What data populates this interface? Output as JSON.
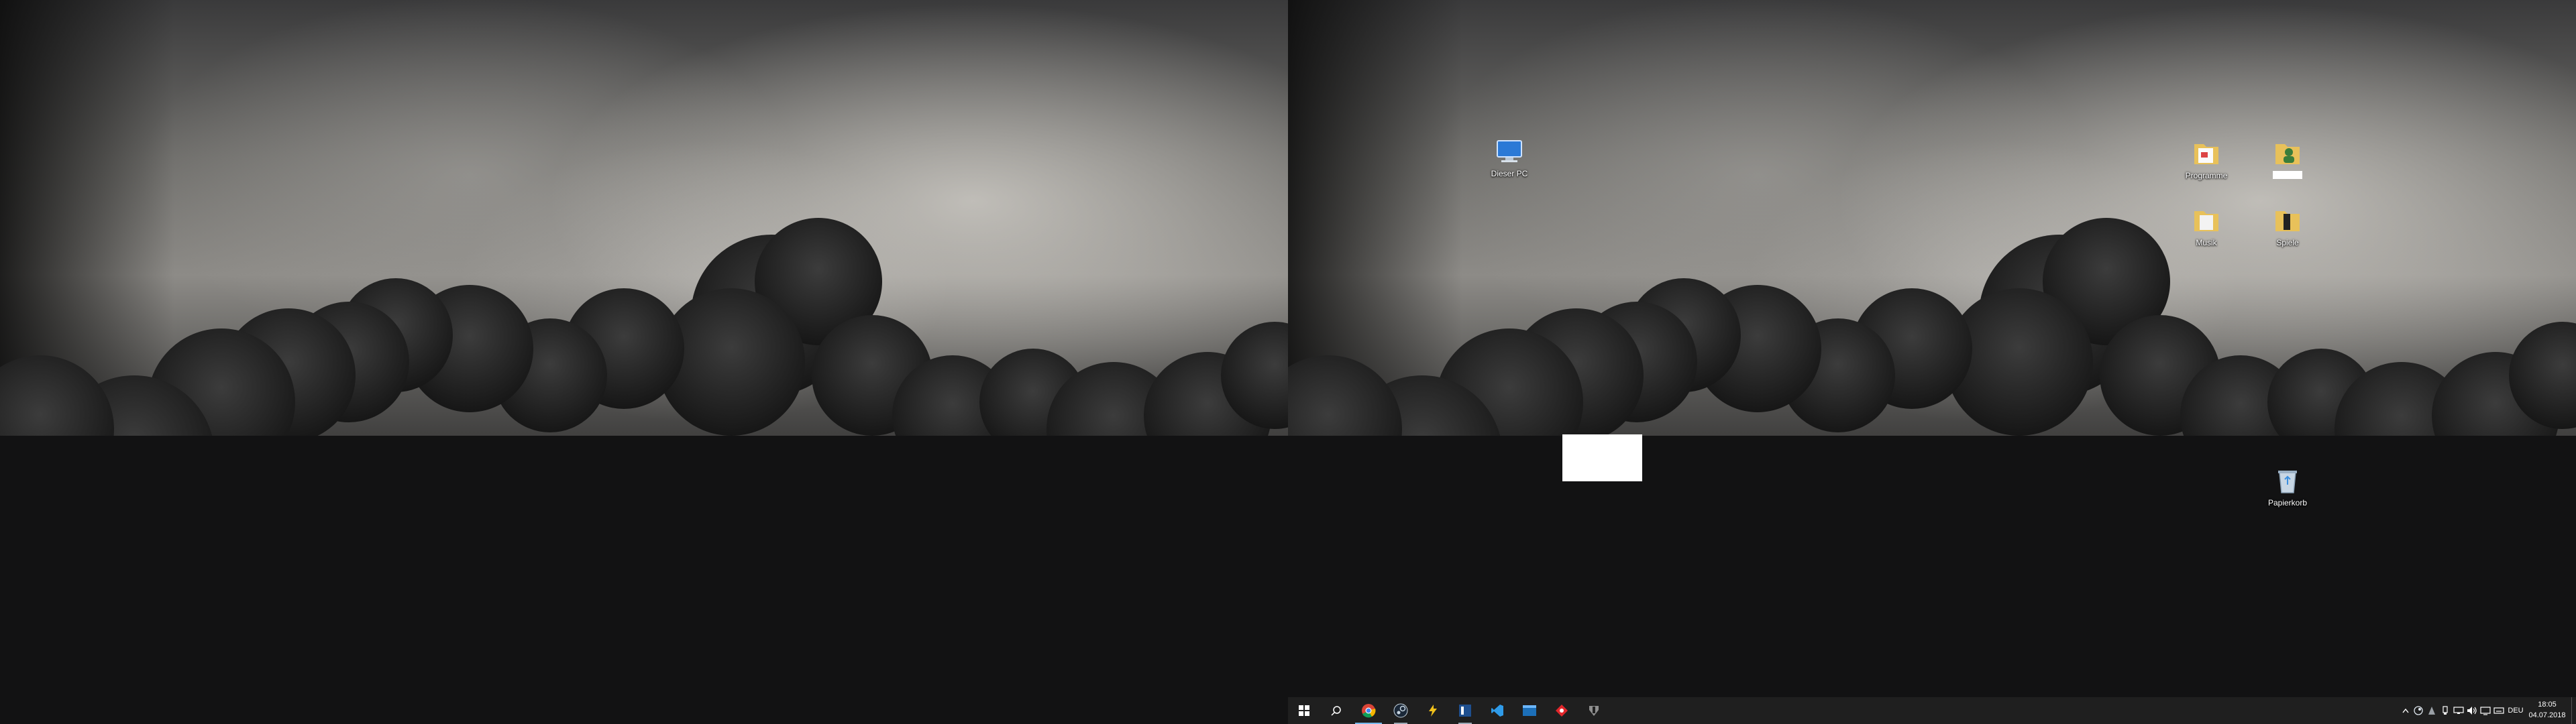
{
  "desktop": {
    "icons": [
      {
        "label": "Dieser PC",
        "icon": "computer-icon"
      },
      {
        "label": "Programme",
        "icon": "folder-icon"
      },
      {
        "label": "",
        "icon": "user-folder-icon"
      },
      {
        "label": "Musik",
        "icon": "folder-icon"
      },
      {
        "label": "Spiele",
        "icon": "folder-icon"
      },
      {
        "label": "Papierkorb",
        "icon": "recycle-bin-icon"
      }
    ]
  },
  "taskbar": {
    "pinned": [
      {
        "name": "start-button",
        "icon": "windows-icon"
      },
      {
        "name": "search-button",
        "icon": "search-icon"
      },
      {
        "name": "chrome",
        "icon": "chrome-icon"
      },
      {
        "name": "steam",
        "icon": "steam-icon"
      },
      {
        "name": "lightning-app",
        "icon": "lightning-icon"
      },
      {
        "name": "blue-app",
        "icon": "square-app-icon"
      },
      {
        "name": "vs-code",
        "icon": "code-icon"
      },
      {
        "name": "blue-app-2",
        "icon": "window-app-icon"
      },
      {
        "name": "red-app",
        "icon": "red-diamond-icon"
      },
      {
        "name": "game-app",
        "icon": "emblem-icon"
      }
    ],
    "tray": {
      "language": "DEU",
      "time": "18:05",
      "date": "04.07.2018"
    }
  },
  "colors": {
    "taskbar": "#1f1f1f",
    "active_indicator": "#76b9ed"
  }
}
